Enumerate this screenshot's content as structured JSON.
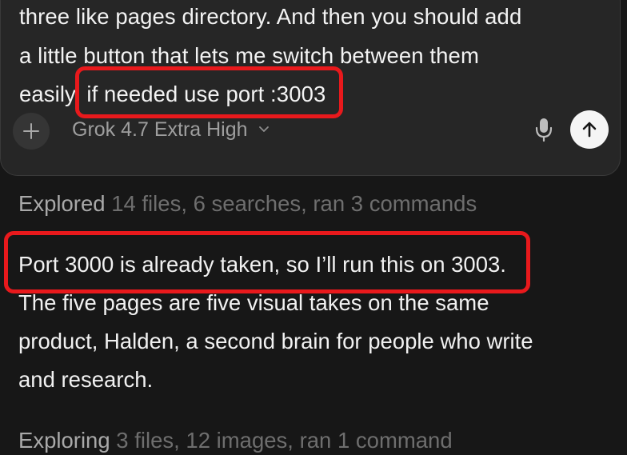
{
  "composer": {
    "prompt_lines": [
      "three like pages directory. And then you should add",
      "a little button that lets me switch between them",
      "easily."
    ],
    "prompt_highlight": "if needed use port :3003",
    "add_icon": "plus-icon",
    "model_label": "Grok 4.7 Extra High",
    "model_chevron_icon": "chevron-down-icon",
    "mic_icon": "microphone-icon",
    "send_icon": "arrow-up-icon"
  },
  "activity": [
    {
      "verb": "Explored",
      "detail": "14 files, 6 searches, ran 3 commands"
    },
    {
      "verb": "Exploring",
      "detail": "3 files, 12 images, ran 1 command"
    }
  ],
  "response": {
    "highlight_line": "Port 3000 is already taken, so I’ll run this on 3003.",
    "lines": [
      "The five pages are five visual takes on the same",
      "product, Halden, a second brain for people who write",
      "and research."
    ]
  },
  "colors": {
    "background": "#171717",
    "composer_bg": "#262626",
    "annotation_red": "#e8191c",
    "send_button": "#f5f5f5"
  }
}
